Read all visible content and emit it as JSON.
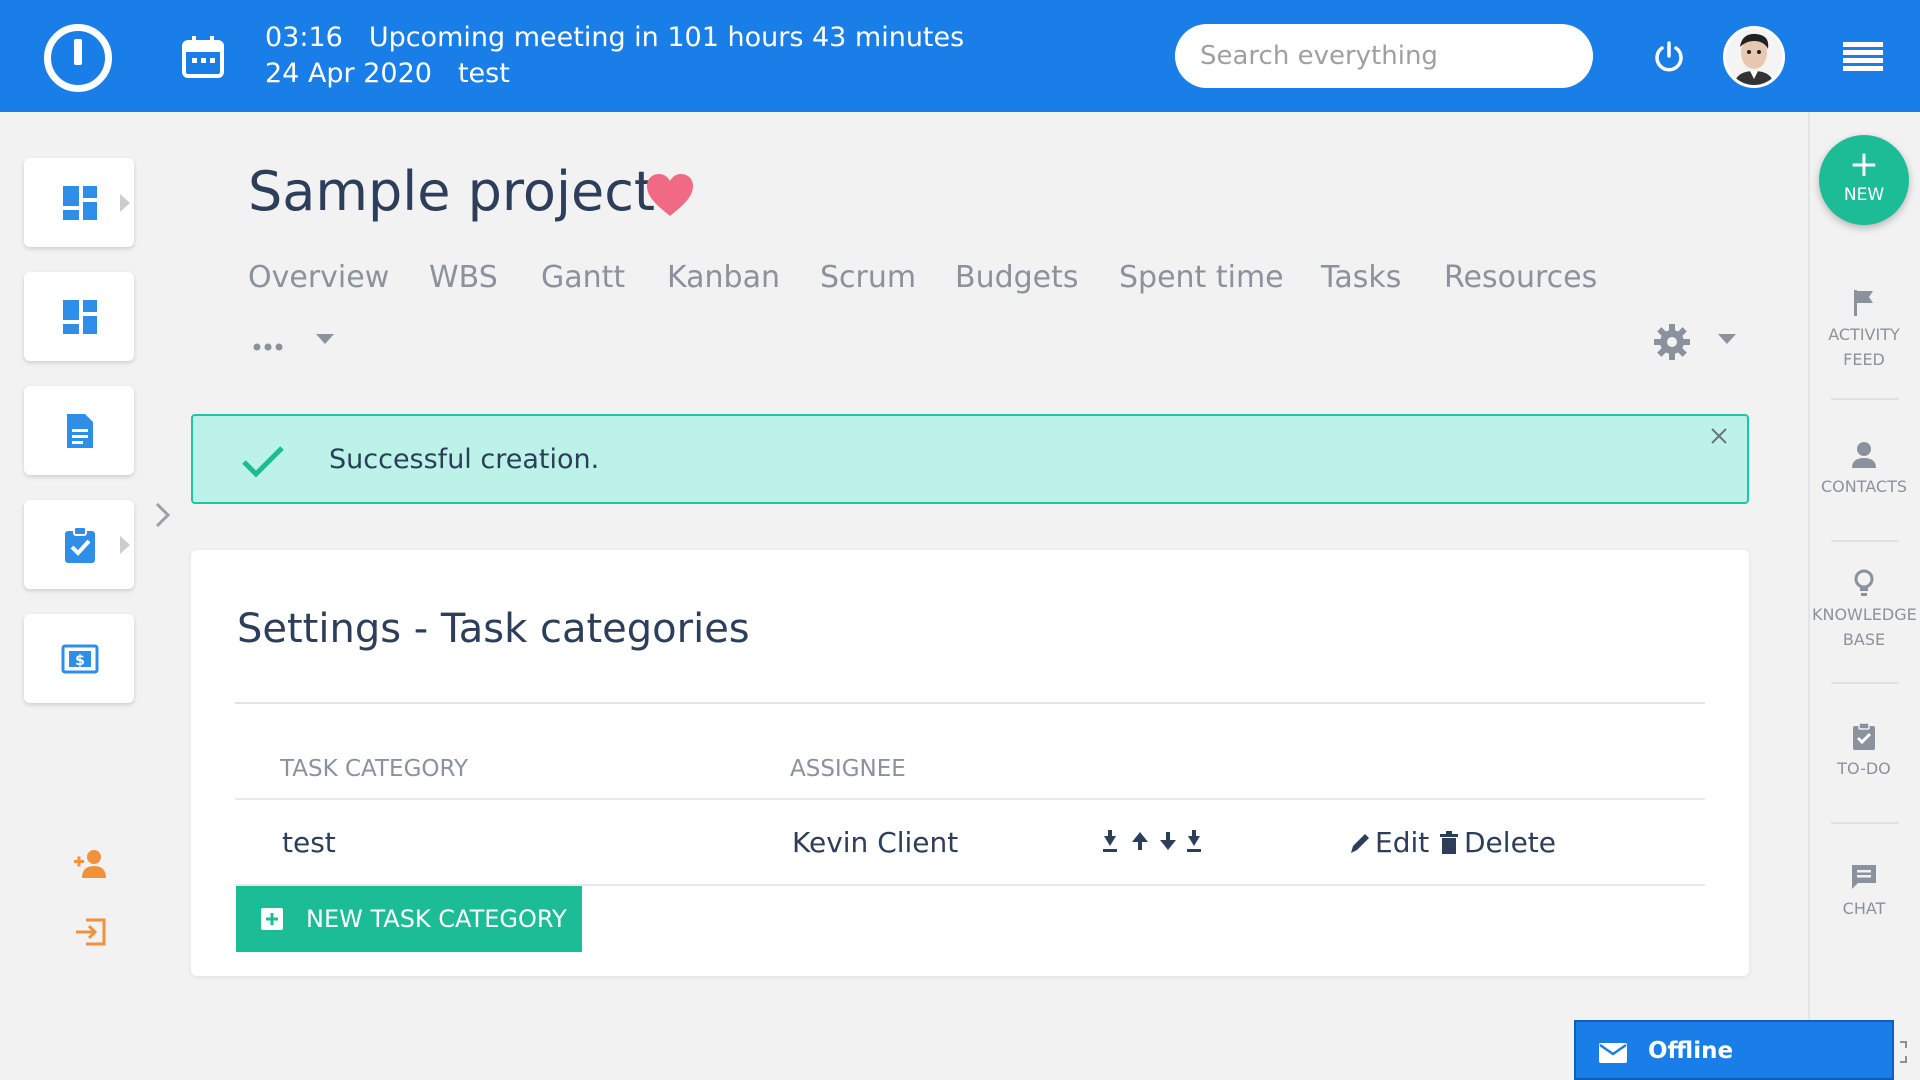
{
  "header": {
    "time": "03:16",
    "meeting": "Upcoming meeting in 101 hours 43 minutes",
    "date": "24 Apr 2020",
    "user_project": "test",
    "search_placeholder": "Search everything"
  },
  "project": {
    "title": "Sample project",
    "tabs": [
      "Overview",
      "WBS",
      "Gantt",
      "Kanban",
      "Scrum",
      "Budgets",
      "Spent time",
      "Tasks",
      "Resources"
    ],
    "more": "..."
  },
  "flash": {
    "message": "Successful creation."
  },
  "settings": {
    "title": "Settings - Task categories",
    "columns": [
      "Task category",
      "Assignee"
    ],
    "rows": [
      {
        "category": "test",
        "assignee": "Kevin Client",
        "edit": "Edit",
        "delete": "Delete"
      }
    ],
    "new_button": "New task category"
  },
  "right_sidebar": {
    "new_label": "NEW",
    "new_plus": "+",
    "items": [
      {
        "icon": "flag-icon",
        "label": "Activity feed"
      },
      {
        "icon": "person-icon",
        "label": "Contacts"
      },
      {
        "icon": "lightbulb-icon",
        "label": "Knowledge base"
      },
      {
        "icon": "clipboard-check-icon",
        "label": "To-do"
      },
      {
        "icon": "chat-icon",
        "label": "Chat"
      }
    ]
  },
  "offline": {
    "label": "Offline"
  },
  "colors": {
    "topbar": "#1a7ee8",
    "accent_green": "#1cbc96",
    "flash_bg": "#bdf2e9",
    "sidebar_icon_blue": "#2f8fe8",
    "orange_icon": "#f2913a",
    "heart": "#f06a85"
  }
}
